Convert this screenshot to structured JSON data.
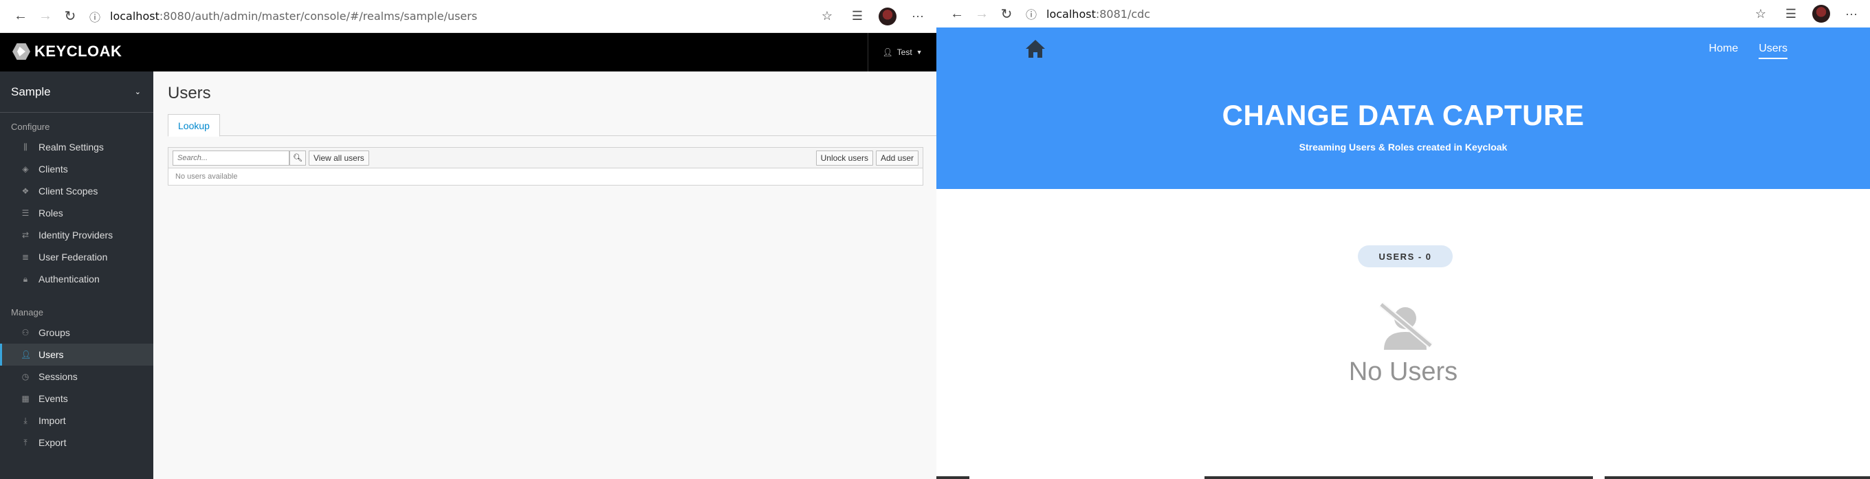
{
  "left_browser": {
    "url_host": "localhost",
    "url_rest": ":8080/auth/admin/master/console/#/realms/sample/users"
  },
  "right_browser": {
    "url_host": "localhost",
    "url_rest": ":8081/cdc"
  },
  "keycloak": {
    "logo_text": "KEYCLOAK",
    "user_menu": "Test",
    "realm": "Sample",
    "sidebar": {
      "configure_title": "Configure",
      "configure_items": [
        {
          "label": "Realm Settings",
          "icon": "sliders-icon"
        },
        {
          "label": "Clients",
          "icon": "cube-icon"
        },
        {
          "label": "Client Scopes",
          "icon": "cubes-icon"
        },
        {
          "label": "Roles",
          "icon": "list-icon"
        },
        {
          "label": "Identity Providers",
          "icon": "exchange-icon"
        },
        {
          "label": "User Federation",
          "icon": "database-icon"
        },
        {
          "label": "Authentication",
          "icon": "lock-icon"
        }
      ],
      "manage_title": "Manage",
      "manage_items": [
        {
          "label": "Groups",
          "icon": "users-icon"
        },
        {
          "label": "Users",
          "icon": "user-icon",
          "active": true
        },
        {
          "label": "Sessions",
          "icon": "clock-icon"
        },
        {
          "label": "Events",
          "icon": "calendar-icon"
        },
        {
          "label": "Import",
          "icon": "import-icon"
        },
        {
          "label": "Export",
          "icon": "export-icon"
        }
      ]
    },
    "main": {
      "title": "Users",
      "tab": "Lookup",
      "search_placeholder": "Search...",
      "view_all": "View all users",
      "unlock": "Unlock users",
      "add_user": "Add user",
      "empty": "No users available"
    }
  },
  "cdc": {
    "nav_home": "Home",
    "nav_users": "Users",
    "title": "CHANGE DATA CAPTURE",
    "subtitle": "Streaming Users & Roles created in Keycloak",
    "users_badge": "USERS - 0",
    "empty": "No Users",
    "accent": "#3f95f9"
  }
}
